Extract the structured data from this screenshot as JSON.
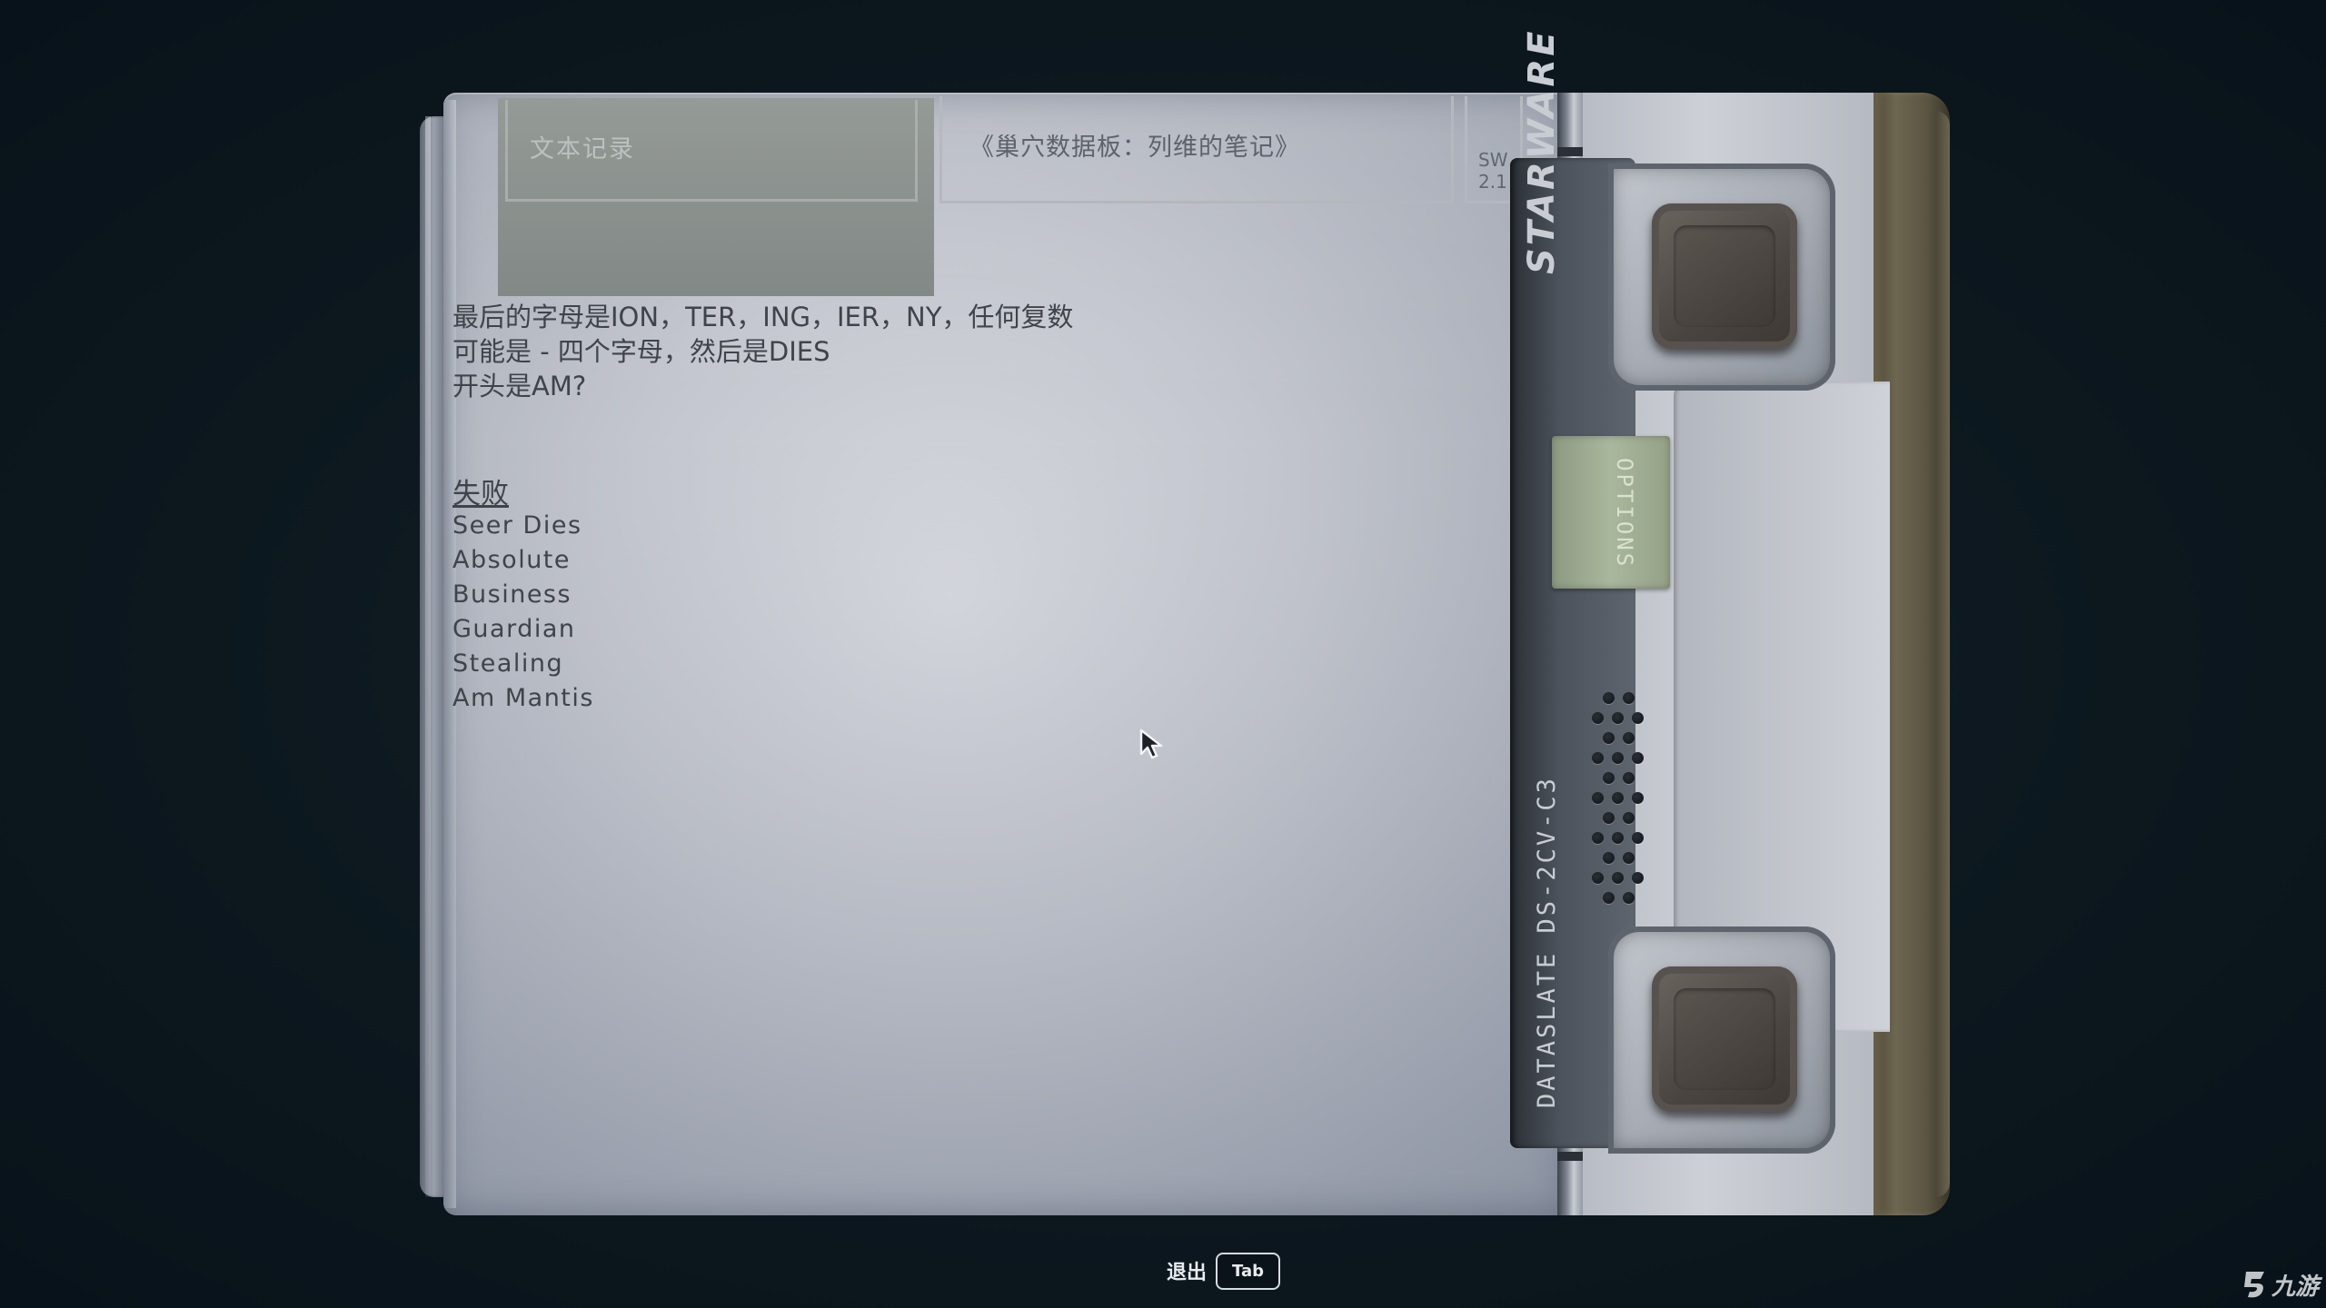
{
  "datapad": {
    "active_tab": "文本记录",
    "document_title": "《巢穴数据板：列维的笔记》",
    "version": [
      "SW",
      "2.1"
    ]
  },
  "note": {
    "lines": [
      "最后的字母是ION，TER，ING，IER，NY，任何复数",
      "可能是 - 四个字母，然后是DIES",
      "开头是AM?"
    ],
    "fail_heading": "失败",
    "failed_words": [
      "Seer Dies",
      "Absolute",
      "Business",
      "Guardian",
      "Stealing",
      "Am Mantis"
    ]
  },
  "device": {
    "brand": "STARWARE",
    "options_label": "OPTIONS",
    "model": "DATASLATE DS-2CV-C3"
  },
  "footer": {
    "exit_label": "退出",
    "exit_key": "Tab"
  },
  "watermark": {
    "text": "九游"
  },
  "colors": {
    "background": "#0c171e",
    "screen": "#c3c6ce",
    "tab_active": "#8e9490",
    "options_button": "#a9b79d",
    "text": "#3f444b"
  }
}
